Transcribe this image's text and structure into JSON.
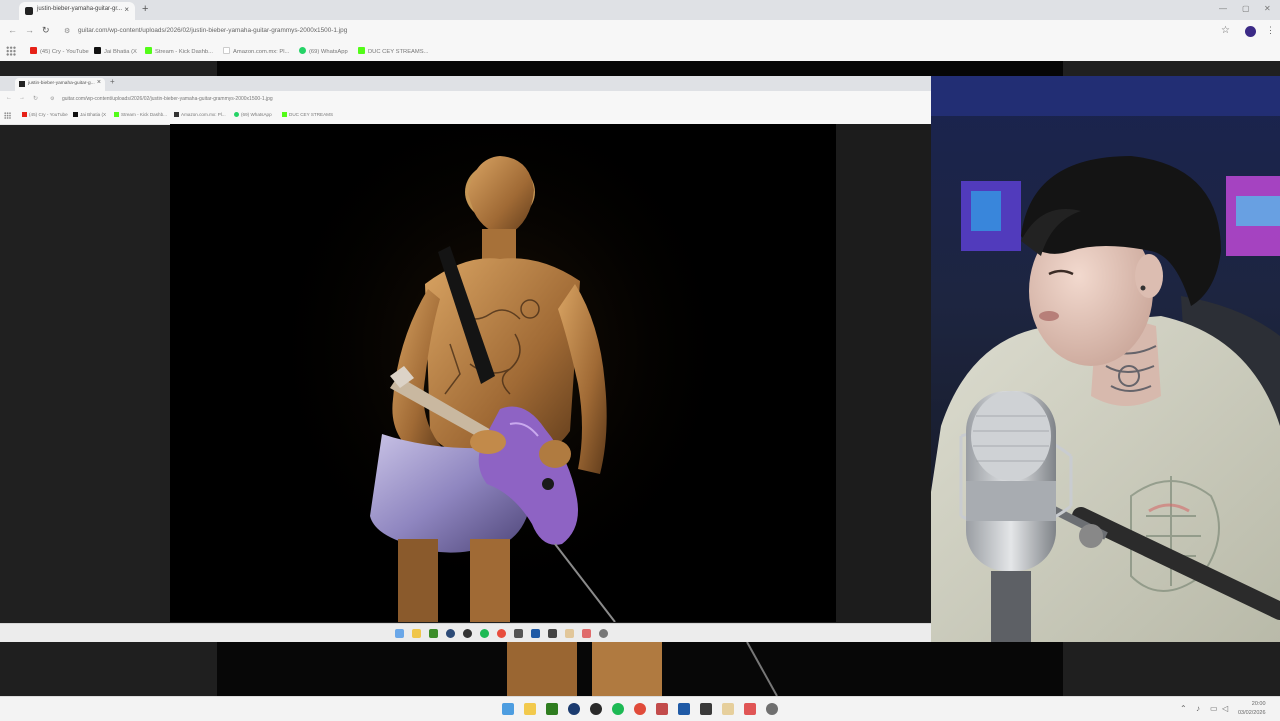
{
  "browser": {
    "tab_title": "justin-bieber-yamaha-guitar-gr...",
    "tab_close": "×",
    "new_tab": "+",
    "url": "guitar.com/wp-content/uploads/2026/02/justin-bieber-yamaha-guitar-grammys-2000x1500-1.jpg",
    "back": "←",
    "forward": "→",
    "reload": "↻",
    "bookmark_star": "☆",
    "menu": "⋮",
    "minimize": "—",
    "maximize": "▢",
    "close": "✕",
    "bookmarks": [
      {
        "label": "(45) Cry - YouTube",
        "color": "#e62117"
      },
      {
        "label": "Jai Bhatia (X",
        "color": "#111111"
      },
      {
        "label": "Stream - Kick Dashb...",
        "color": "#53fc18"
      },
      {
        "label": "Amazon.com.mx: Pl...",
        "color": "#222222"
      },
      {
        "label": "(69) WhatsApp",
        "color": "#25d366"
      },
      {
        "label": "DUC CEY STREAMS...",
        "color": "#53fc18"
      }
    ]
  },
  "inner_browser": {
    "tab_title": "justin-bieber-yamaha-guitar-g...",
    "tab_close": "×",
    "new_tab": "+",
    "url": "guitar.com/wp-content/uploads/2026/02/justin-bieber-yamaha-guitar-grammys-2000x1500-1.jpg",
    "bookmarks": [
      {
        "label": "(45) Cry - YouTube",
        "color": "#e62117"
      },
      {
        "label": "Jai Bhatia (X",
        "color": "#111111"
      },
      {
        "label": "Stream - Kick Dashb...",
        "color": "#53fc18"
      },
      {
        "label": "Amazon.com.mx: Pl...",
        "color": "#222222"
      },
      {
        "label": "(69) WhatsApp",
        "color": "#25d366"
      },
      {
        "label": "DUC CEY STREAMS",
        "color": "#53fc18"
      }
    ]
  },
  "taskbar": {
    "icons": [
      "windows-icon",
      "file-explorer-icon",
      "nvidia-icon",
      "steam-icon",
      "obs-icon",
      "spotify-icon",
      "chrome-icon",
      "app-icon",
      "terminal-icon",
      "notepad-icon",
      "brave-icon",
      "settings-icon"
    ],
    "time": "20:00",
    "date": "03/02/2026"
  },
  "colors": {
    "accent_purple": "#3b2a86",
    "taskbar_bg": "#f3f3f3"
  }
}
